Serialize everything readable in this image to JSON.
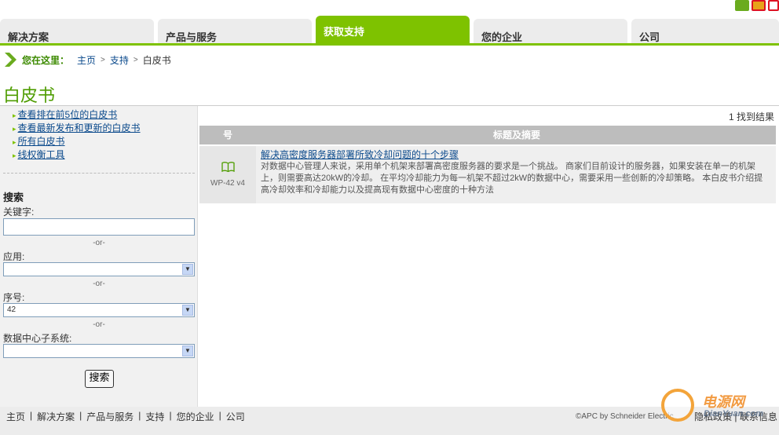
{
  "nav": {
    "tabs": [
      {
        "label": "解决方案"
      },
      {
        "label": "产品与服务"
      },
      {
        "label": "获取支持",
        "active": true
      },
      {
        "label": "您的企业"
      },
      {
        "label": "公司"
      }
    ],
    "accent_color": "#7ec200"
  },
  "breadcrumb": {
    "label": "您在这里：",
    "items": [
      "主页",
      "支持",
      "白皮书"
    ],
    "separator": ">"
  },
  "page_title": "白皮书",
  "sidebar": {
    "links": [
      {
        "label": "查看排在前5位的白皮书"
      },
      {
        "label": "查看最新发布和更新的白皮书"
      },
      {
        "label": "所有白皮书"
      },
      {
        "label": "线权衡工具"
      }
    ],
    "search": {
      "heading": "搜索",
      "keyword_label": "关键字:",
      "keyword_value": "",
      "or_text": "-or-",
      "application_label": "应用:",
      "application_value": "",
      "number_label": "序号:",
      "number_value": "42",
      "subsystem_label": "数据中心子系统:",
      "subsystem_value": "",
      "button_label": "搜索"
    }
  },
  "results": {
    "count_text": "1 找到结果",
    "headers": {
      "number": "号",
      "title": "标题及摘要"
    },
    "rows": [
      {
        "id": "WP-42 v4",
        "icon": "book-icon",
        "title": "解决高密度服务器部署所致冷却问题的十个步骤",
        "description": "对数据中心管理人来说，采用单个机架来部署高密度服务器的要求是一个挑战。 商家们目前设计的服务器，如果安装在单一的机架上，则需要高达20kW的冷却。 在平均冷却能力为每一机架不超过2kW的数据中心，需要采用一些创新的冷却策略。 本白皮书介绍提高冷却效率和冷却能力以及提高现有数据中心密度的十种方法"
      }
    ]
  },
  "footer": {
    "links": [
      "主页",
      "解决方案",
      "产品与服务",
      "支持",
      "您的企业",
      "公司"
    ],
    "copyright": "©APC by Schneider Electric",
    "right_links": [
      "隐私政策",
      "联系信息"
    ]
  },
  "watermark": {
    "text": "电源网",
    "sub": "DianYuan.com"
  }
}
